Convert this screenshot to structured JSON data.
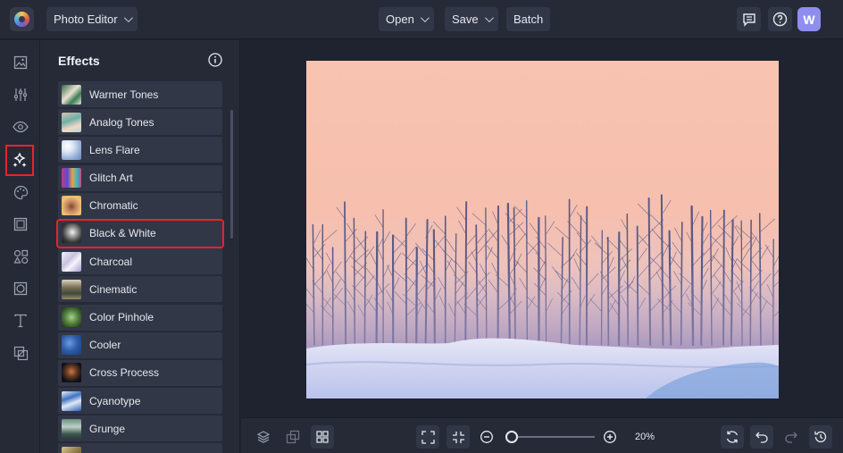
{
  "header": {
    "app_menu_label": "Photo Editor",
    "open_label": "Open",
    "save_label": "Save",
    "batch_label": "Batch",
    "avatar_initial": "W"
  },
  "rail": {
    "items": [
      {
        "icon": "image-icon"
      },
      {
        "icon": "sliders-icon"
      },
      {
        "icon": "eye-icon"
      },
      {
        "icon": "effects-sparkle-icon",
        "active": true
      },
      {
        "icon": "palette-icon"
      },
      {
        "icon": "frame-icon"
      },
      {
        "icon": "shapes-icon"
      },
      {
        "icon": "overlay-icon"
      },
      {
        "icon": "text-icon"
      },
      {
        "icon": "graphics-icon"
      }
    ]
  },
  "panel": {
    "title": "Effects",
    "items": [
      {
        "label": "Warmer Tones"
      },
      {
        "label": "Analog Tones"
      },
      {
        "label": "Lens Flare"
      },
      {
        "label": "Glitch Art"
      },
      {
        "label": "Chromatic"
      },
      {
        "label": "Black & White",
        "selected": true
      },
      {
        "label": "Charcoal"
      },
      {
        "label": "Cinematic"
      },
      {
        "label": "Color Pinhole"
      },
      {
        "label": "Cooler"
      },
      {
        "label": "Cross Process"
      },
      {
        "label": "Cyanotype"
      },
      {
        "label": "Grunge"
      },
      {
        "label": ""
      }
    ]
  },
  "canvas": {
    "zoom_label": "20%",
    "zoom_fraction": 0.05
  },
  "colors": {
    "accent_highlight": "#e8232b",
    "avatar": "#8f8ef0",
    "background": "#1f2330",
    "panel": "#262a37"
  }
}
